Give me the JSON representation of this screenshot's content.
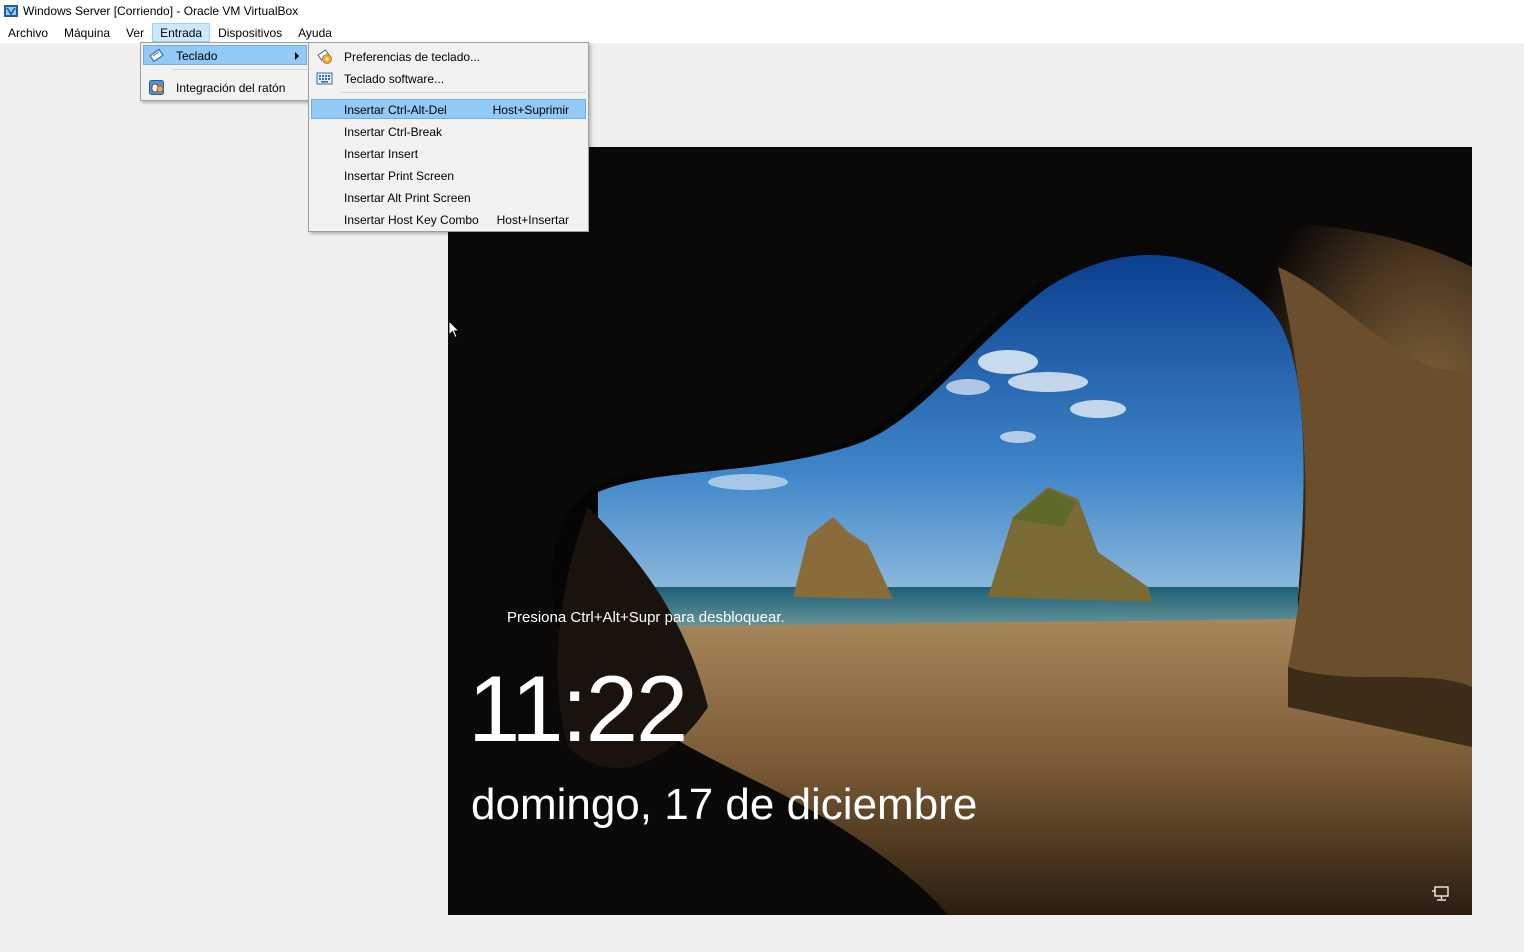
{
  "window": {
    "title": "Windows Server [Corriendo] - Oracle VM VirtualBox",
    "app_icon": "virtualbox-icon"
  },
  "menubar": {
    "items": [
      "Archivo",
      "Máquina",
      "Ver",
      "Entrada",
      "Dispositivos",
      "Ayuda"
    ],
    "active": "Entrada"
  },
  "entrada_menu": {
    "items": [
      {
        "label": "Teclado",
        "icon": "keyboard-pencil-icon",
        "submenu": true
      },
      {
        "label": "Integración del ratón",
        "icon": "mouse-integration-icon",
        "submenu": false
      }
    ]
  },
  "teclado_menu": {
    "items": [
      {
        "label": "Preferencias de teclado...",
        "icon": "keyboard-settings-icon",
        "shortcut": ""
      },
      {
        "label": "Teclado software...",
        "icon": "soft-keyboard-icon",
        "shortcut": ""
      },
      {
        "label": "Insertar Ctrl-Alt-Del",
        "shortcut": "Host+Suprimir"
      },
      {
        "label": "Insertar Ctrl-Break",
        "shortcut": ""
      },
      {
        "label": "Insertar Insert",
        "shortcut": ""
      },
      {
        "label": "Insertar Print Screen",
        "shortcut": ""
      },
      {
        "label": "Insertar Alt Print Screen",
        "shortcut": ""
      },
      {
        "label": "Insertar Host Key Combo",
        "shortcut": "Host+Insertar"
      }
    ]
  },
  "lockscreen": {
    "prompt": "Presiona Ctrl+Alt+Supr para desbloquear.",
    "time": "11:22",
    "date": "domingo, 17 de diciembre",
    "network_icon": "network-icon"
  },
  "colors": {
    "menu_highlight": "#91c9f7",
    "menubar_active": "#cce8ff",
    "menu_background": "#f2f2f2"
  }
}
